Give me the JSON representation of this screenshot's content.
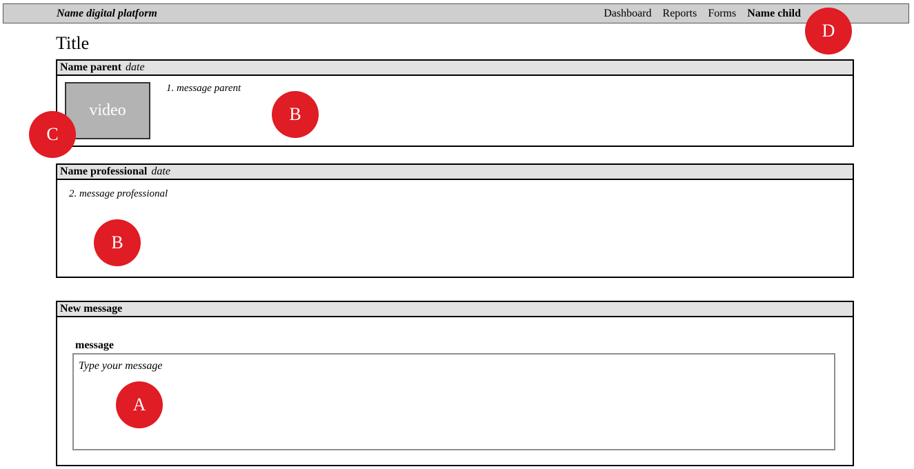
{
  "topbar": {
    "brand": "Name digital platform",
    "nav": [
      "Dashboard",
      "Reports",
      "Forms"
    ],
    "active_user": "Name child"
  },
  "title": "Title",
  "panels": [
    {
      "name": "Name parent",
      "date": "date",
      "message": "1. message parent",
      "video_label": "video"
    },
    {
      "name": "Name professional",
      "date": "date",
      "message": "2. message professional"
    }
  ],
  "new_message": {
    "header": "New message",
    "field_label": "message",
    "placeholder": "Type your message"
  },
  "markers": [
    "A",
    "B",
    "B",
    "C",
    "D"
  ],
  "colors": {
    "marker": "#e01c24",
    "header_bg": "#e2e2e2",
    "topbar_bg": "#cfcfcf",
    "video_bg": "#b3b3b3"
  }
}
